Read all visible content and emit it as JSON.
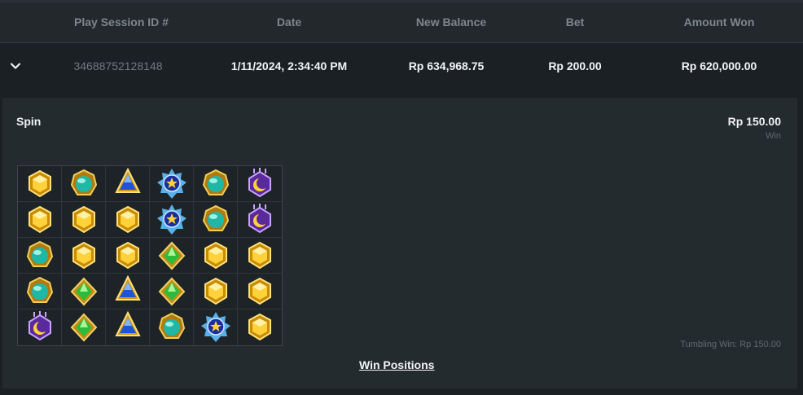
{
  "columns": [
    "Play Session ID #",
    "Date",
    "New Balance",
    "Bet",
    "Amount Won"
  ],
  "row": {
    "session_id": "34688752128148",
    "date": "1/11/2024, 2:34:40 PM",
    "new_balance": "Rp 634,968.75",
    "bet": "Rp 200.00",
    "amount_won": "Rp 620,000.00"
  },
  "details": {
    "spin_label": "Spin",
    "spin_amount": "Rp 150.00",
    "spin_sub": "Win",
    "tumbling": "Tumbling Win: Rp 150.00",
    "win_positions_link": "Win Positions"
  },
  "grid_symbols": [
    [
      "gold-gem",
      "teal-gem",
      "blue-gem",
      "star-medallion",
      "teal-gem",
      "purple-moon"
    ],
    [
      "gold-gem",
      "gold-gem",
      "gold-gem",
      "star-medallion",
      "teal-gem",
      "purple-moon"
    ],
    [
      "teal-gem",
      "gold-gem",
      "gold-gem",
      "green-gem",
      "gold-gem",
      "gold-gem"
    ],
    [
      "teal-gem",
      "green-gem",
      "blue-gem",
      "green-gem",
      "gold-gem",
      "gold-gem"
    ],
    [
      "purple-moon",
      "green-gem",
      "blue-gem",
      "teal-gem",
      "star-medallion",
      "gold-gem"
    ]
  ],
  "colors": {
    "background": "#1b2024",
    "header": "#22282c",
    "panel": "#242b2f",
    "muted": "#7d878d"
  }
}
